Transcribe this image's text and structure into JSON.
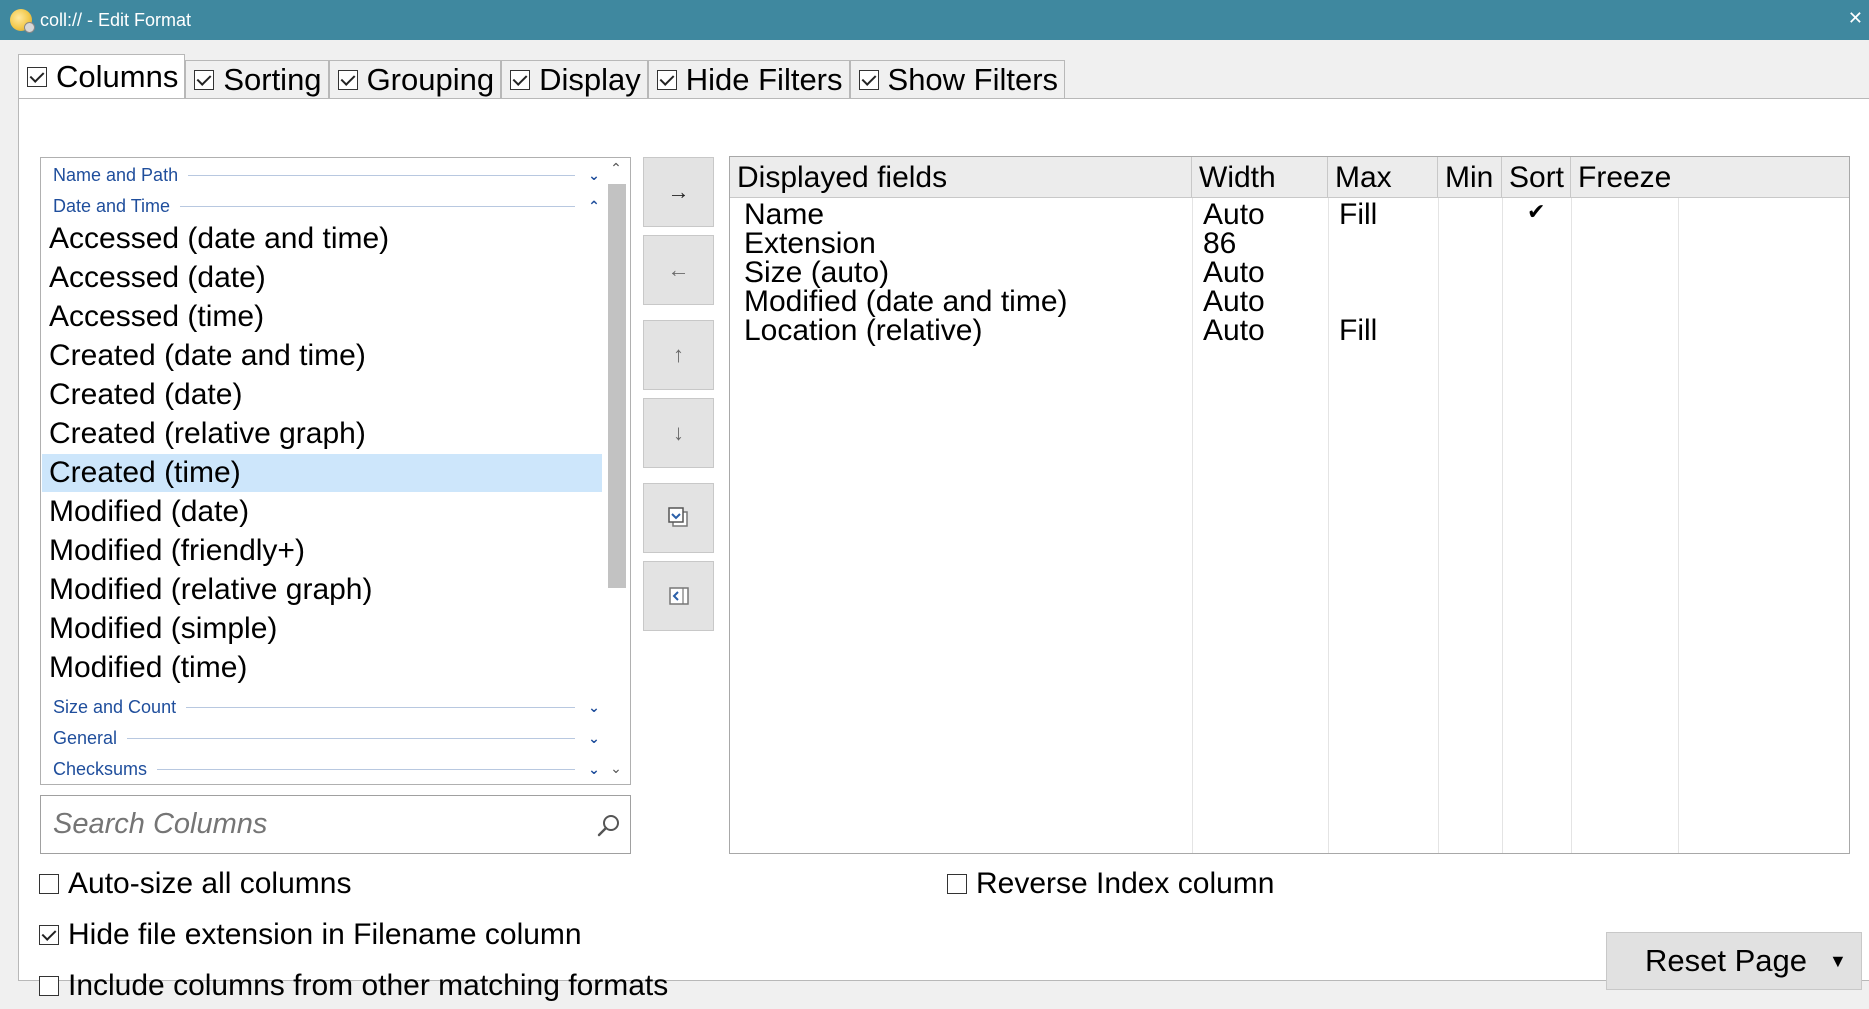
{
  "window": {
    "title": "coll:// - Edit Format"
  },
  "tabs": [
    {
      "label": "Columns",
      "checked": true
    },
    {
      "label": "Sorting",
      "checked": true
    },
    {
      "label": "Grouping",
      "checked": true
    },
    {
      "label": "Display",
      "checked": true
    },
    {
      "label": "Hide Filters",
      "checked": true
    },
    {
      "label": "Show Filters",
      "checked": true
    }
  ],
  "field_list": {
    "groups": {
      "name_path": "Name and Path",
      "date_time": "Date and Time",
      "size_count": "Size and Count",
      "general": "General",
      "checksums": "Checksums"
    },
    "items": [
      "Accessed (date and time)",
      "Accessed (date)",
      "Accessed (time)",
      "Created (date and time)",
      "Created (date)",
      "Created (relative graph)",
      "Created (time)",
      "Modified (date)",
      "Modified (friendly+)",
      "Modified (relative graph)",
      "Modified (simple)",
      "Modified (time)"
    ],
    "selected": "Created (time)"
  },
  "search": {
    "placeholder": "Search Columns"
  },
  "buttons": {
    "add": "→",
    "remove": "←",
    "up": "↑",
    "down": "↓"
  },
  "table": {
    "headers": [
      "Displayed fields",
      "Width",
      "Max",
      "Min",
      "Sort",
      "Freeze"
    ],
    "rows": [
      {
        "field": "Name",
        "width": "Auto",
        "max": "Fill",
        "min": "",
        "sort": "✔",
        "freeze": ""
      },
      {
        "field": "Extension",
        "width": "86",
        "max": "",
        "min": "",
        "sort": "",
        "freeze": ""
      },
      {
        "field": "Size (auto)",
        "width": "Auto",
        "max": "",
        "min": "",
        "sort": "",
        "freeze": ""
      },
      {
        "field": "Modified (date and time)",
        "width": "Auto",
        "max": "",
        "min": "",
        "sort": "",
        "freeze": ""
      },
      {
        "field": "Location (relative)",
        "width": "Auto",
        "max": "Fill",
        "min": "",
        "sort": "",
        "freeze": ""
      }
    ]
  },
  "options": {
    "autosize": {
      "label": "Auto-size all columns",
      "checked": false
    },
    "hide_ext": {
      "label": "Hide file extension in Filename column",
      "checked": true
    },
    "include_cols": {
      "label": "Include columns from other matching formats",
      "checked": false
    },
    "reverse_index": {
      "label": "Reverse Index column",
      "checked": false
    }
  },
  "reset": {
    "label": "Reset Page"
  },
  "colors": {
    "titlebar": "#3f889f",
    "selection": "#cde6fb",
    "group_text": "#1f4e9c"
  }
}
